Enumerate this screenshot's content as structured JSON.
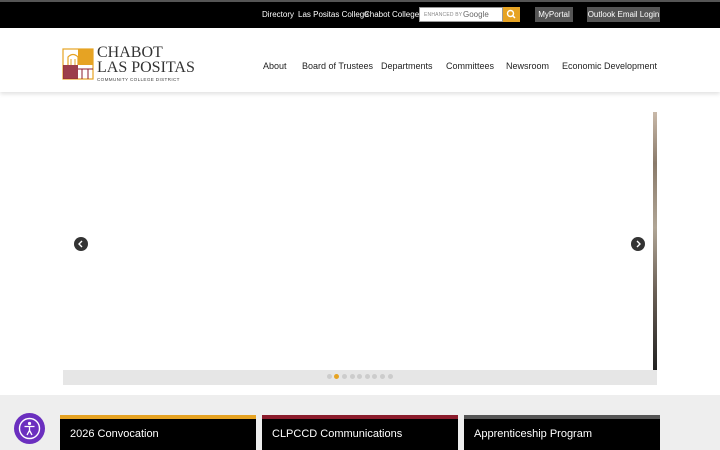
{
  "topbar": {
    "links": [
      "Directory",
      "Las Positas College",
      "Chabot College"
    ],
    "search": {
      "enhanced_by": "ENHANCED BY",
      "brand": "Google",
      "icon": "search-icon"
    },
    "buttons": [
      "MyPortal",
      "Outlook Email Login"
    ]
  },
  "logo": {
    "line1": "CHABOT",
    "line2": "LAS POSITAS",
    "line3": "COMMUNITY COLLEGE DISTRICT"
  },
  "nav": [
    "About",
    "Board of Trustees",
    "Departments",
    "Committees",
    "Newsroom",
    "Economic Development"
  ],
  "slider": {
    "prev_icon": "chevron-left-icon",
    "next_icon": "chevron-right-icon",
    "slide_count": 9,
    "active_slide": 2
  },
  "cards": [
    {
      "title": "2026 Convocation",
      "accent": "#e6a323"
    },
    {
      "title": "CLPCCD Communications",
      "accent": "#8b1c2c"
    },
    {
      "title": "Apprenticeship Program",
      "accent": "#555555"
    }
  ],
  "accessibility": {
    "icon": "accessibility-icon",
    "color": "#6b2fbf"
  },
  "colors": {
    "gold": "#e6a323",
    "black": "#000000",
    "button_gray": "#555555"
  }
}
